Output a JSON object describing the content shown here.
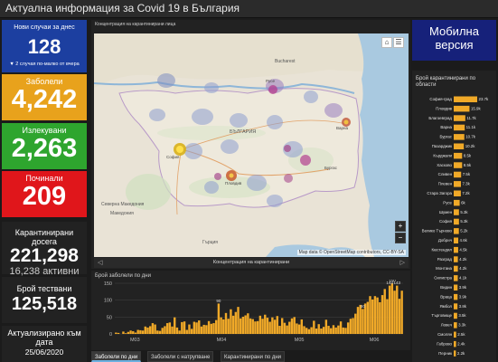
{
  "header": {
    "title": "Актуална информация за Covid 19 в България"
  },
  "stats": {
    "new_cases": {
      "label": "Нови случаи за днес",
      "value": "128",
      "sub": "▼ 2 случая по-малко от вчера",
      "color": "#1c3fa0"
    },
    "infected": {
      "label": "Заболели",
      "value": "4,242",
      "color": "#e8a21c"
    },
    "recovered": {
      "label": "Излекувани",
      "value": "2,263",
      "color": "#2ea52e"
    },
    "deaths": {
      "label": "Починали",
      "value": "209",
      "color": "#e0161b"
    },
    "quarantined": {
      "label": "Карантинирани досега",
      "value": "221,298",
      "sub": "16,238 активни"
    },
    "tested": {
      "label": "Брой тествани",
      "value": "125,518"
    },
    "updated": {
      "label": "Актуализирано към дата",
      "value": "25/06/2020"
    }
  },
  "mobile": {
    "label_line1": "Мобилна",
    "label_line2": "версия",
    "color": "#16217a"
  },
  "map": {
    "title": "Концентрация на карантинирани лица",
    "footer": "Концентрация на карантинирани",
    "attribution": "Map data © OpenStreetMap contributors, CC-BY-SA",
    "cities": {
      "bucharest": "Bucharest",
      "bulgaria": "БЪЛГАРИЯ",
      "north_macedonia": "Северна Македония",
      "macedonia": "Македония",
      "greece": "Гърция",
      "sofia": "София",
      "plovdiv": "Пловдив",
      "varna": "Варна",
      "burgas": "Бургас",
      "ruse": "Русе"
    },
    "zoom_in": "+",
    "zoom_out": "−",
    "home_icon": "home-icon",
    "list_icon": "list-icon"
  },
  "regions_panel": {
    "title": "Брой карантинирани по области",
    "regions": [
      {
        "name": "София-град",
        "value": "23.7k"
      },
      {
        "name": "Пловдив",
        "value": "15.9k"
      },
      {
        "name": "Благоевград",
        "value": "11.7k"
      },
      {
        "name": "Варна",
        "value": "11.1k"
      },
      {
        "name": "Бургас",
        "value": "10.7k"
      },
      {
        "name": "Пазарджик",
        "value": "10.2k"
      },
      {
        "name": "Кърджали",
        "value": "8.5k"
      },
      {
        "name": "Хасково",
        "value": "8.5k"
      },
      {
        "name": "Сливен",
        "value": "7.5k"
      },
      {
        "name": "Плевен",
        "value": "7.3k"
      },
      {
        "name": "Стара Загора",
        "value": "7.2k"
      },
      {
        "name": "Русе",
        "value": "6k"
      },
      {
        "name": "Шумен",
        "value": "5.3k"
      },
      {
        "name": "София",
        "value": "5.3k"
      },
      {
        "name": "Велико Търново",
        "value": "5.2k"
      },
      {
        "name": "Добрич",
        "value": "4.6k"
      },
      {
        "name": "Кюстендил",
        "value": "4.5k"
      },
      {
        "name": "Разград",
        "value": "4.2k"
      },
      {
        "name": "Монтана",
        "value": "4.2k"
      },
      {
        "name": "Силистра",
        "value": "4.1k"
      },
      {
        "name": "Видин",
        "value": "3.9k"
      },
      {
        "name": "Враца",
        "value": "3.9k"
      },
      {
        "name": "Ямбол",
        "value": "3.8k"
      },
      {
        "name": "Търговище",
        "value": "3.5k"
      },
      {
        "name": "Ловеч",
        "value": "3.3k"
      },
      {
        "name": "Смолян",
        "value": "2.5k"
      },
      {
        "name": "Габрово",
        "value": "2.4k"
      },
      {
        "name": "Перник",
        "value": "2.2k"
      }
    ]
  },
  "chart_data": {
    "type": "bar",
    "title": "Брой заболели по дни",
    "ylim": [
      0,
      150
    ],
    "yticks": [
      0,
      50,
      100,
      150
    ],
    "xtick_labels": [
      "М03",
      "М04",
      "М05",
      "М06"
    ],
    "grid": true,
    "color": "#f0a928",
    "values": [
      4,
      3,
      0,
      7,
      2,
      6,
      10,
      8,
      4,
      12,
      11,
      10,
      22,
      19,
      23,
      32,
      28,
      10,
      9,
      18,
      23,
      32,
      34,
      22,
      49,
      19,
      10,
      35,
      37,
      12,
      28,
      15,
      36,
      34,
      40,
      22,
      27,
      26,
      38,
      30,
      32,
      41,
      90,
      49,
      43,
      62,
      45,
      73,
      54,
      65,
      80,
      46,
      51,
      55,
      61,
      46,
      44,
      37,
      38,
      54,
      45,
      57,
      48,
      36,
      49,
      42,
      53,
      24,
      47,
      33,
      25,
      36,
      46,
      50,
      31,
      28,
      43,
      23,
      18,
      14,
      20,
      39,
      16,
      29,
      16,
      21,
      42,
      24,
      17,
      26,
      19,
      25,
      37,
      19,
      18,
      34,
      45,
      47,
      60,
      80,
      86,
      74,
      90,
      95,
      112,
      102,
      112,
      108,
      94,
      115,
      133,
      103,
      143,
      150,
      128,
      143,
      104,
      128
    ],
    "value_labels": [
      {
        "index": 42,
        "text": "90"
      },
      {
        "index": 101,
        "text": "80"
      },
      {
        "index": 112,
        "text": "143"
      },
      {
        "index": 113,
        "text": "150"
      },
      {
        "index": 115,
        "text": "143"
      }
    ]
  },
  "tabs": [
    {
      "label": "Заболели по дни",
      "active": true
    },
    {
      "label": "Заболели с натрупване",
      "active": false
    },
    {
      "label": "Карантинирани по дни",
      "active": false
    }
  ]
}
